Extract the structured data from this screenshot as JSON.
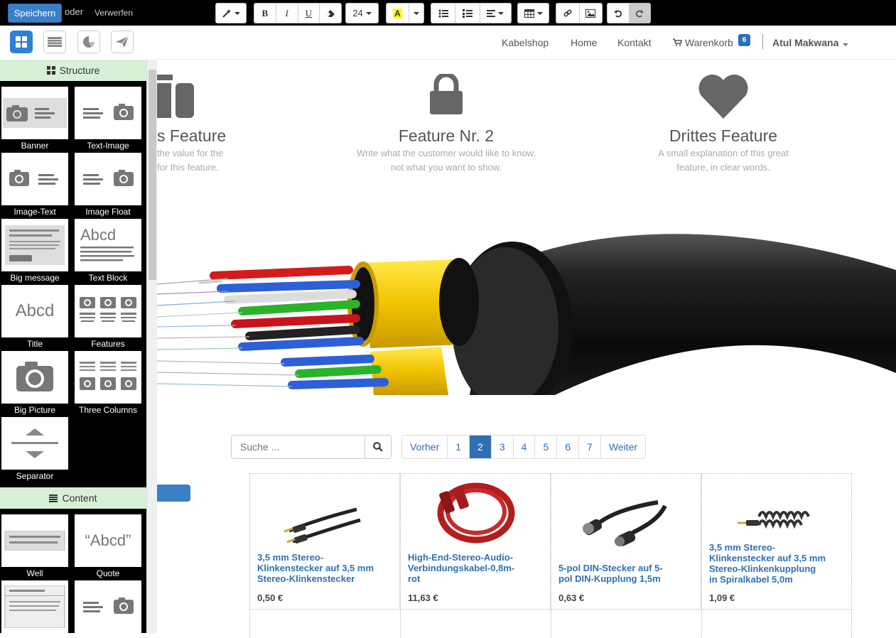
{
  "toolbar": {
    "save_label": "Speichern",
    "or_text": "oder",
    "discard_label": "Verwerfen",
    "font_size": "24",
    "bold": "B",
    "italic": "I",
    "underline": "U"
  },
  "sidebar": {
    "categories": [
      {
        "label": "Structure"
      },
      {
        "label": "Content"
      }
    ],
    "snippets": [
      {
        "label": "Banner"
      },
      {
        "label": "Text-Image"
      },
      {
        "label": "Image-Text"
      },
      {
        "label": "Image Float"
      },
      {
        "label": "Big message"
      },
      {
        "label": "Text Block"
      },
      {
        "label": "Title"
      },
      {
        "label": "Features"
      },
      {
        "label": "Big Picture"
      },
      {
        "label": "Three Columns"
      },
      {
        "label": "Separator"
      },
      {
        "label": "Well"
      },
      {
        "label": "Quote"
      }
    ],
    "thumb_text": {
      "abcd": "Abcd",
      "quote": "“Abcd”"
    }
  },
  "nav": {
    "links": [
      "Kabelshop",
      "Home",
      "Kontakt"
    ],
    "cart_label": "Warenkorb",
    "cart_count": "6",
    "user": "Atul Makwana"
  },
  "features": [
    {
      "title": "s Feature",
      "text_lines": [
        "the value for the",
        "for this feature."
      ]
    },
    {
      "title": "Feature Nr. 2",
      "text_lines": [
        "Write what the customer would like to know,",
        "not what you want to show."
      ]
    },
    {
      "title": "Drittes Feature",
      "text_lines": [
        "A small explanation of this great",
        "feature, in clear words."
      ]
    }
  ],
  "search": {
    "placeholder": "Suche ..."
  },
  "pager": {
    "prev": "Vorher",
    "pages": [
      "1",
      "2",
      "3",
      "4",
      "5",
      "6",
      "7"
    ],
    "active_page": "2",
    "next": "Weiter"
  },
  "products": [
    {
      "name_lines": [
        "3,5 mm Stereo-",
        "Klinkenstecker auf 3,5 mm",
        "Stereo-Klinkenstecker"
      ],
      "price": "0,50 €"
    },
    {
      "name_lines": [
        "High-End-Stereo-Audio-",
        "Verbindungskabel-0,8m-",
        "rot"
      ],
      "price": "11,63 €"
    },
    {
      "name_lines": [
        "5-pol DIN-Stecker auf 5-",
        "pol DIN-Kupplung 1,5m"
      ],
      "price": "0,63 €"
    },
    {
      "name_lines": [
        "3,5 mm Stereo-",
        "Klinkenstecker auf 3,5 mm",
        "Stereo-Klinkenkupplung",
        "in Spiralkabel 5,0m"
      ],
      "price": "1,09 €"
    }
  ],
  "colors": {
    "accent": "#2f6fb6",
    "save_button": "#3b7fc7",
    "category_header": "#d8f0d8",
    "feature_icon": "#666666"
  }
}
